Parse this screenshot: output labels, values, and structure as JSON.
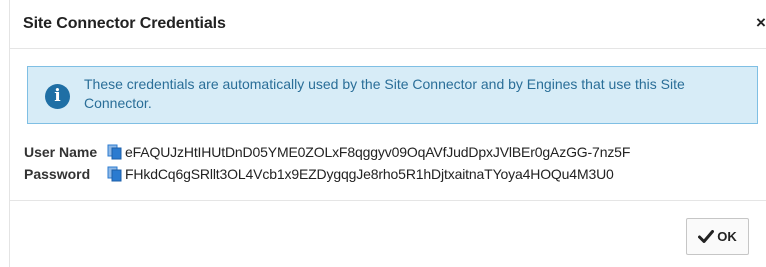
{
  "dialog": {
    "title": "Site Connector Credentials",
    "close_glyph": "×"
  },
  "info": {
    "icon": "info-icon",
    "icon_glyph": "i",
    "message": "These credentials are automatically used by the Site Connector and by Engines that use this Site Connector."
  },
  "credentials": {
    "user_name_label": "User Name",
    "user_name_value": "eFAQUJzHtIHUtDnD05YME0ZOLxF8qggyv09OqAVfJudDpxJVlBEr0gAzGG-7nz5F",
    "password_label": "Password",
    "password_value": "FHkdCq6gSRllt3OL4Vcb1x9EZDygqgJe8rho5R1hDjtxaitnaTYoya4HOQu4M3U0",
    "copy_icon": "copy-icon"
  },
  "footer": {
    "ok_label": "OK",
    "ok_icon": "check-icon"
  },
  "colors": {
    "info_background": "#d7ecf7",
    "info_border": "#7fbfe4",
    "info_text": "#2a6e98",
    "info_icon": "#1f6fa5",
    "copy_icon": "#2b7bd0"
  }
}
